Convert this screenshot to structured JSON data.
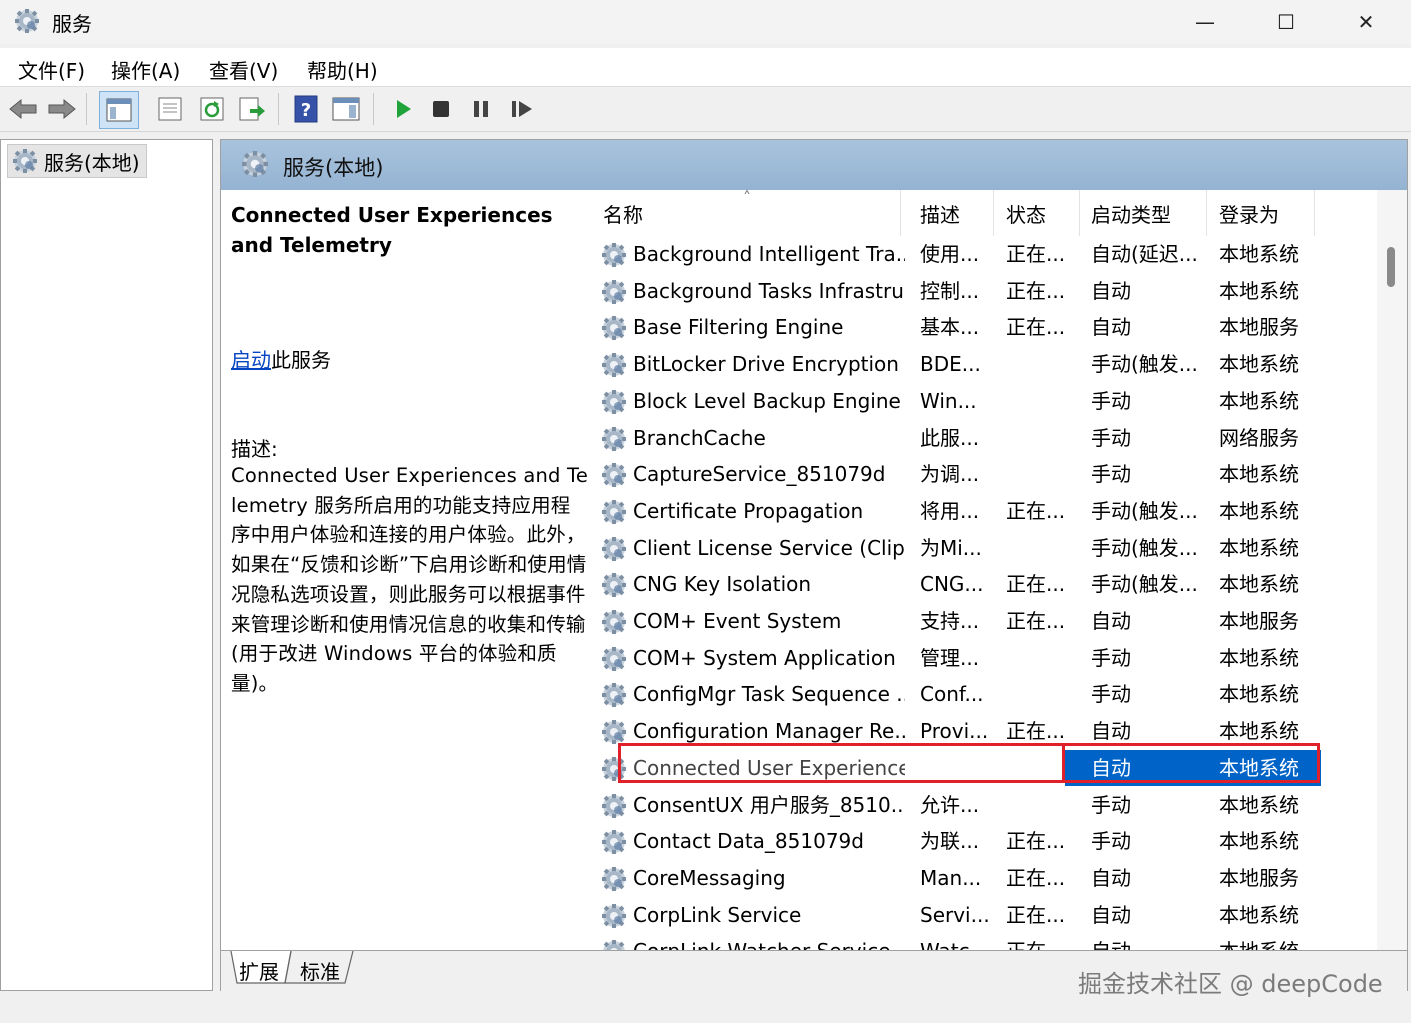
{
  "window": {
    "title": "服务",
    "minimize": "—",
    "maximize": "☐",
    "close": "✕"
  },
  "menu": [
    "文件(F)",
    "操作(A)",
    "查看(V)",
    "帮助(H)"
  ],
  "toolbar": {
    "icons": [
      "back-arrow-icon",
      "forward-arrow-icon",
      "console-tree-icon",
      "properties-icon",
      "refresh-icon",
      "export-list-icon",
      "help-icon",
      "show-hide-action-pane-icon",
      "start-service-icon",
      "stop-service-icon",
      "pause-service-icon",
      "resume-service-icon"
    ]
  },
  "tree": {
    "root_label": "服务(本地)"
  },
  "pane_header": {
    "title": "服务(本地)"
  },
  "details": {
    "service_title": "Connected User Experiences and Telemetry",
    "start_link": "启动",
    "start_suffix": "此服务",
    "desc_label": "描述:",
    "desc_text": "Connected User Experiences and Telemetry 服务所启用的功能支持应用程序中用户体验和连接的用户体验。此外，如果在“反馈和诊断”下启用诊断和使用情况隐私选项设置，则此服务可以根据事件来管理诊断和使用情况信息的收集和传输(用于改进 Windows 平台的体验和质量)。"
  },
  "columns": {
    "name": "名称",
    "desc": "描述",
    "state": "状态",
    "type": "启动类型",
    "logon": "登录为"
  },
  "rows": [
    {
      "name": "Background Intelligent Tra...",
      "desc": "使用...",
      "state": "正在...",
      "type": "自动(延迟...",
      "logon": "本地系统"
    },
    {
      "name": "Background Tasks Infrastru...",
      "desc": "控制...",
      "state": "正在...",
      "type": "自动",
      "logon": "本地系统"
    },
    {
      "name": "Base Filtering Engine",
      "desc": "基本...",
      "state": "正在...",
      "type": "自动",
      "logon": "本地服务"
    },
    {
      "name": "BitLocker Drive Encryption ...",
      "desc": "BDE...",
      "state": "",
      "type": "手动(触发...",
      "logon": "本地系统"
    },
    {
      "name": "Block Level Backup Engine ...",
      "desc": "Win...",
      "state": "",
      "type": "手动",
      "logon": "本地系统"
    },
    {
      "name": "BranchCache",
      "desc": "此服...",
      "state": "",
      "type": "手动",
      "logon": "网络服务"
    },
    {
      "name": "CaptureService_851079d",
      "desc": "为调...",
      "state": "",
      "type": "手动",
      "logon": "本地系统"
    },
    {
      "name": "Certificate Propagation",
      "desc": "将用...",
      "state": "正在...",
      "type": "手动(触发...",
      "logon": "本地系统"
    },
    {
      "name": "Client License Service (Clip...",
      "desc": "为Mi...",
      "state": "",
      "type": "手动(触发...",
      "logon": "本地系统"
    },
    {
      "name": "CNG Key Isolation",
      "desc": "CNG...",
      "state": "正在...",
      "type": "手动(触发...",
      "logon": "本地系统"
    },
    {
      "name": "COM+ Event System",
      "desc": "支持...",
      "state": "正在...",
      "type": "自动",
      "logon": "本地服务"
    },
    {
      "name": "COM+ System Application",
      "desc": "管理...",
      "state": "",
      "type": "手动",
      "logon": "本地系统"
    },
    {
      "name": "ConfigMgr Task Sequence ...",
      "desc": "Conf...",
      "state": "",
      "type": "手动",
      "logon": "本地系统"
    },
    {
      "name": "Configuration Manager Re...",
      "desc": "Provi...",
      "state": "正在...",
      "type": "自动",
      "logon": "本地系统"
    },
    {
      "name": "Connected User Experiences and Telemetry",
      "desc": "",
      "state": "",
      "type": "自动",
      "logon": "本地系统",
      "selected": true
    },
    {
      "name": "ConsentUX 用户服务_8510...",
      "desc": "允许...",
      "state": "",
      "type": "手动",
      "logon": "本地系统"
    },
    {
      "name": "Contact Data_851079d",
      "desc": "为联...",
      "state": "正在...",
      "type": "手动",
      "logon": "本地系统"
    },
    {
      "name": "CoreMessaging",
      "desc": "Man...",
      "state": "正在...",
      "type": "自动",
      "logon": "本地服务"
    },
    {
      "name": "CorpLink Service",
      "desc": "Servi...",
      "state": "正在...",
      "type": "自动",
      "logon": "本地系统"
    },
    {
      "name": "CorpLink Watcher Service",
      "desc": "Watc...",
      "state": "正在...",
      "type": "自动",
      "logon": "本地系统"
    }
  ],
  "bottom_tabs": [
    "扩展",
    "标准"
  ],
  "watermark": "掘金技术社区 @ deepCode",
  "colors": {
    "selection": "#0063c7",
    "highlight_border": "#e0202a",
    "header_band": "#a9c3dd",
    "link": "#0645c2"
  }
}
